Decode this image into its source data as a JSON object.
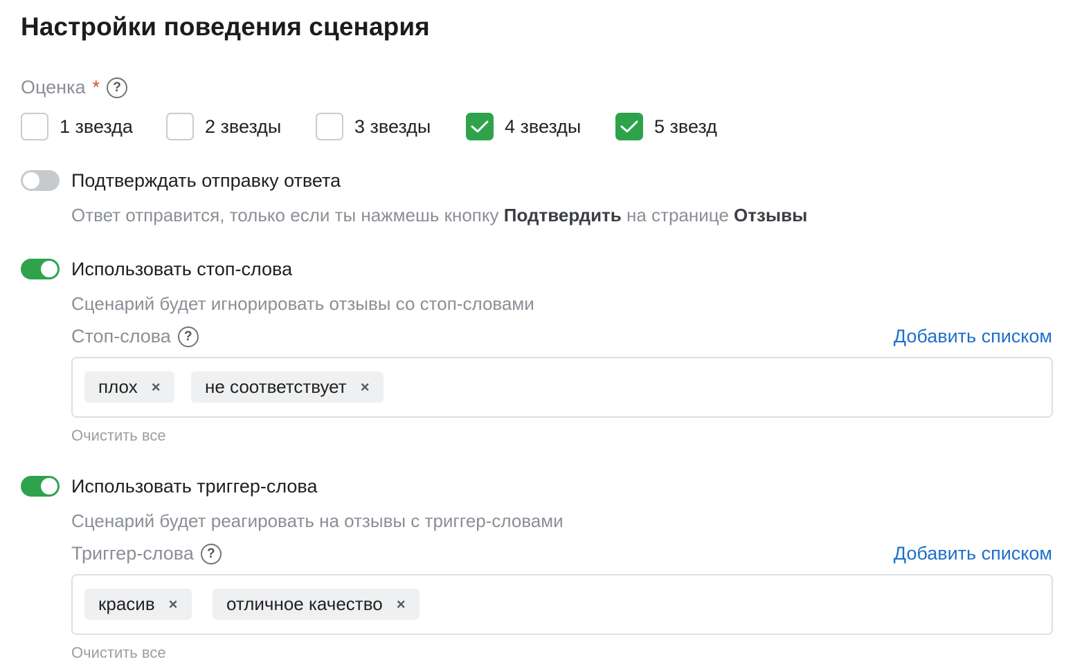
{
  "page": {
    "title": "Настройки поведения сценария"
  },
  "rating": {
    "label": "Оценка",
    "required_mark": "*",
    "help_glyph": "?",
    "options": [
      {
        "label": "1 звезда",
        "checked": false
      },
      {
        "label": "2 звезды",
        "checked": false
      },
      {
        "label": "3 звезды",
        "checked": false
      },
      {
        "label": "4 звезды",
        "checked": true
      },
      {
        "label": "5 звезд",
        "checked": true
      }
    ]
  },
  "confirm_reply": {
    "enabled": false,
    "title": "Подтверждать отправку ответа",
    "desc_prefix": "Ответ отправится, только если ты нажмешь кнопку ",
    "desc_bold_1": "Подтвердить",
    "desc_middle": " на странице ",
    "desc_bold_2": "Отзывы"
  },
  "stop_words": {
    "enabled": true,
    "title": "Использовать стоп-слова",
    "description": "Сценарий будет игнорировать отзывы со стоп-словами",
    "field_label": "Стоп-слова",
    "help_glyph": "?",
    "add_link": "Добавить списком",
    "tags": [
      "плох",
      "не соответствует"
    ],
    "remove_glyph": "×",
    "clear_all": "Очистить все"
  },
  "trigger_words": {
    "enabled": true,
    "title": "Использовать триггер-слова",
    "description": "Сценарий будет реагировать на отзывы с триггер-словами",
    "field_label": "Триггер-слова",
    "help_glyph": "?",
    "add_link": "Добавить списком",
    "tags": [
      "красив",
      "отличное качество"
    ],
    "remove_glyph": "×",
    "clear_all": "Очистить все"
  },
  "colors": {
    "accent_green": "#2ea34b",
    "link_blue": "#1f6fc9",
    "required_red": "#e0452f"
  }
}
